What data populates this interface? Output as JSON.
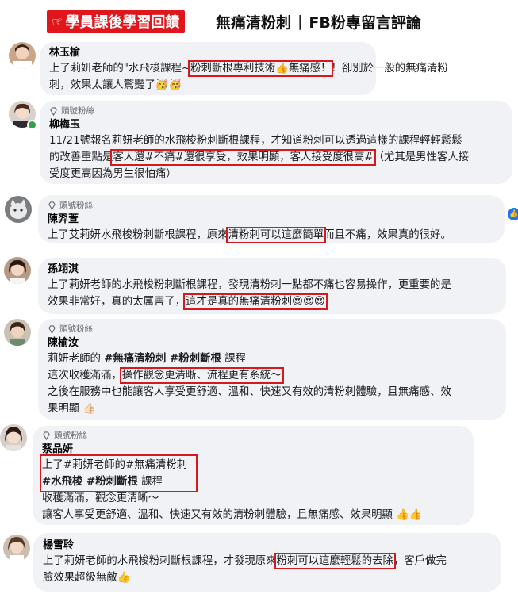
{
  "header": {
    "badge": "學員課後學習回饋",
    "title_main": "無痛清粉刺",
    "separator": "|",
    "title_sub": "FB粉專留言評論"
  },
  "fan_label": "頭號粉絲",
  "comments": [
    {
      "name": "林玉榆",
      "lines": [
        [
          "上了莉妍老師的\"水飛梭課程~",
          "粉刺斷根專利技術👍無痛感！",
          "！卻別於一般的無痛清粉"
        ],
        [
          "刺，效果太讓人驚豔了🥳🥳"
        ]
      ]
    },
    {
      "name": "柳梅玉",
      "lines": [
        [
          "11/21號報名莉妍老師的水飛梭粉刺斷根課程，才知道粉刺可以透過這樣的課程輕輕鬆鬆"
        ],
        [
          "的改善重點是",
          "客人還#不痛#還很享受，效果明顯，客人接受度很高#",
          "（尤其是男性客人接"
        ],
        [
          "受度更高因為男生很怕痛）"
        ]
      ]
    },
    {
      "name": "陳羿萱",
      "lines": [
        [
          "上了艾莉妍水飛梭粉刺斷根課程，原來",
          "清粉刺可以這麼簡單",
          "而且不痛，效果真的很好。"
        ]
      ]
    },
    {
      "name": "孫翊淇",
      "lines": [
        [
          "上了莉妍老師的水飛梭粉刺斷根課程，發現清粉刺一點都不痛也容易操作，更重要的是"
        ],
        [
          "效果非常好，真的太厲害了，",
          "這才是真的無痛清粉刺😍😍😍"
        ]
      ]
    },
    {
      "name": "陳榆汝",
      "lines": [
        [
          "莉妍老師的 ",
          "#無痛清粉刺 #粉刺斷根",
          " 課程"
        ],
        [
          "這次收穫滿滿，",
          "操作觀念更清晰、流程更有系統～"
        ],
        [
          "之後在服務中也能讓客人享受更舒適、溫和、快速又有效的清粉刺體驗，且無痛感、效"
        ],
        [
          "果明顯 👍🏻"
        ]
      ]
    },
    {
      "name": "蔡品妍",
      "lines": [
        [
          "上了#莉妍老師的#無痛清粉刺"
        ],
        [
          "#水飛梭 #粉刺斷根",
          " 課程"
        ],
        [
          "收穫滿滿，觀念更清晰～"
        ],
        [
          "讓客人享受更舒適、溫和、快速又有效的清粉刺體驗，且無痛感、效果明顯 👍👍"
        ]
      ]
    },
    {
      "name": "楊雪聆",
      "lines": [
        [
          "上了莉妍老師的水飛梭粉刺斷根課程，才發現原來",
          "粉刺可以這麼輕鬆的去除",
          "，客戶做完"
        ],
        [
          "臉效果超級無敵👍"
        ]
      ]
    }
  ]
}
